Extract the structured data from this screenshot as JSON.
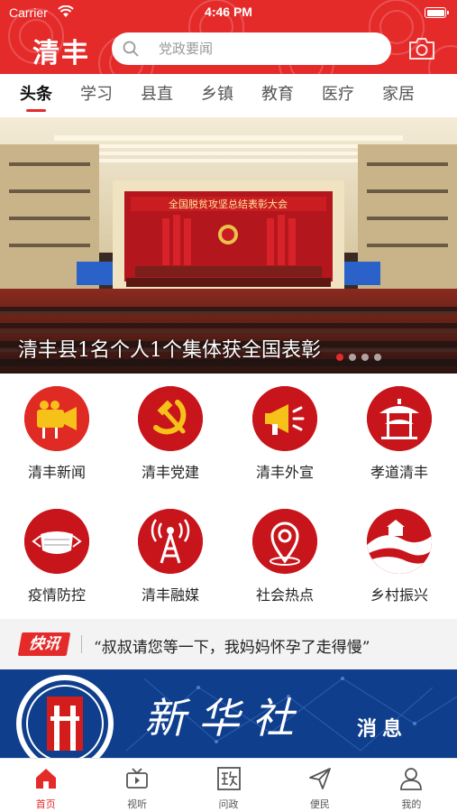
{
  "status_bar": {
    "carrier": "Carrier",
    "time": "4:46 PM"
  },
  "header": {
    "logo": "清丰",
    "search_placeholder": "党政要闻"
  },
  "tabs": [
    {
      "label": "头条",
      "active": true
    },
    {
      "label": "学习"
    },
    {
      "label": "县直"
    },
    {
      "label": "乡镇"
    },
    {
      "label": "教育"
    },
    {
      "label": "医疗"
    },
    {
      "label": "家居"
    }
  ],
  "banner": {
    "hall_banner_text": "全国脱贫攻坚总结表彰大会",
    "caption": "清丰县1名个人1个集体获全国表彰",
    "slide_count": 4,
    "active_slide": 1
  },
  "grid": [
    {
      "label": "清丰新闻",
      "icon": "video-camera-icon"
    },
    {
      "label": "清丰党建",
      "icon": "hammer-sickle-icon"
    },
    {
      "label": "清丰外宣",
      "icon": "megaphone-icon"
    },
    {
      "label": "孝道清丰",
      "icon": "pavilion-icon"
    },
    {
      "label": "疫情防控",
      "icon": "face-mask-icon"
    },
    {
      "label": "清丰融媒",
      "icon": "broadcast-tower-icon"
    },
    {
      "label": "社会热点",
      "icon": "location-pin-icon"
    },
    {
      "label": "乡村振兴",
      "icon": "countryside-icon"
    }
  ],
  "news_flash": {
    "tag": "快讯",
    "text": "“叔叔请您等一下，我妈妈怀孕了走得慢”"
  },
  "promo": {
    "title": "新华社",
    "subtitle": "消息"
  },
  "tabbar": [
    {
      "label": "首页",
      "icon": "home-icon",
      "active": true
    },
    {
      "label": "视听",
      "icon": "tv-icon"
    },
    {
      "label": "问政",
      "icon": "zheng-icon"
    },
    {
      "label": "便民",
      "icon": "send-icon"
    },
    {
      "label": "我的",
      "icon": "user-icon"
    }
  ],
  "colors": {
    "brand_red": "#e52a2a",
    "promo_blue": "#0f3e8c"
  }
}
